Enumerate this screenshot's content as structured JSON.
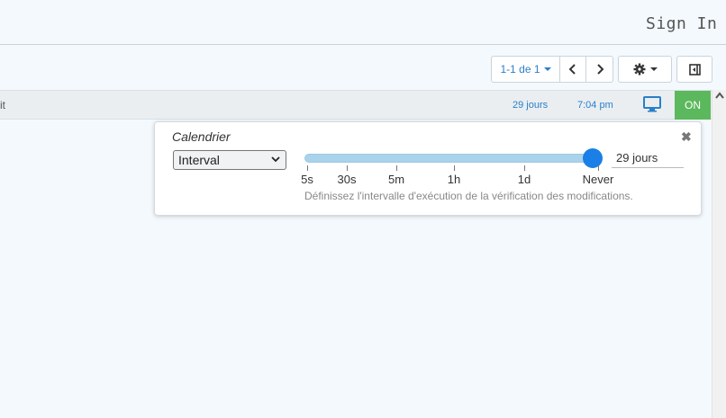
{
  "header": {
    "signin_label": "Sign In"
  },
  "toolbar": {
    "pagination_label": "1-1 de 1"
  },
  "row": {
    "fragment": "it",
    "age": "29 jours",
    "time": "7:04 pm",
    "status_label": "ON",
    "status_color": "#5cb85c"
  },
  "scheduler": {
    "title": "Calendrier",
    "mode_selected": "Interval",
    "slider_ticks": [
      "5s",
      "30s",
      "5m",
      "1h",
      "1d",
      "Never"
    ],
    "slider_value_fraction": 1.0,
    "value_display": "29 jours",
    "hint": "Définissez l'intervalle d'exécution de la vérification des modifications."
  },
  "icons": {
    "prev": "chevron-left-icon",
    "next": "chevron-right-icon",
    "settings": "gear-icon",
    "collapse": "collapse-sidebar-icon",
    "monitor": "monitor-icon",
    "close": "close-icon",
    "scroll_up": "chevron-up-icon"
  },
  "colors": {
    "accent": "#2a7fc9",
    "slider_thumb": "#1a7fe6",
    "slider_track": "#a9d3ea"
  }
}
